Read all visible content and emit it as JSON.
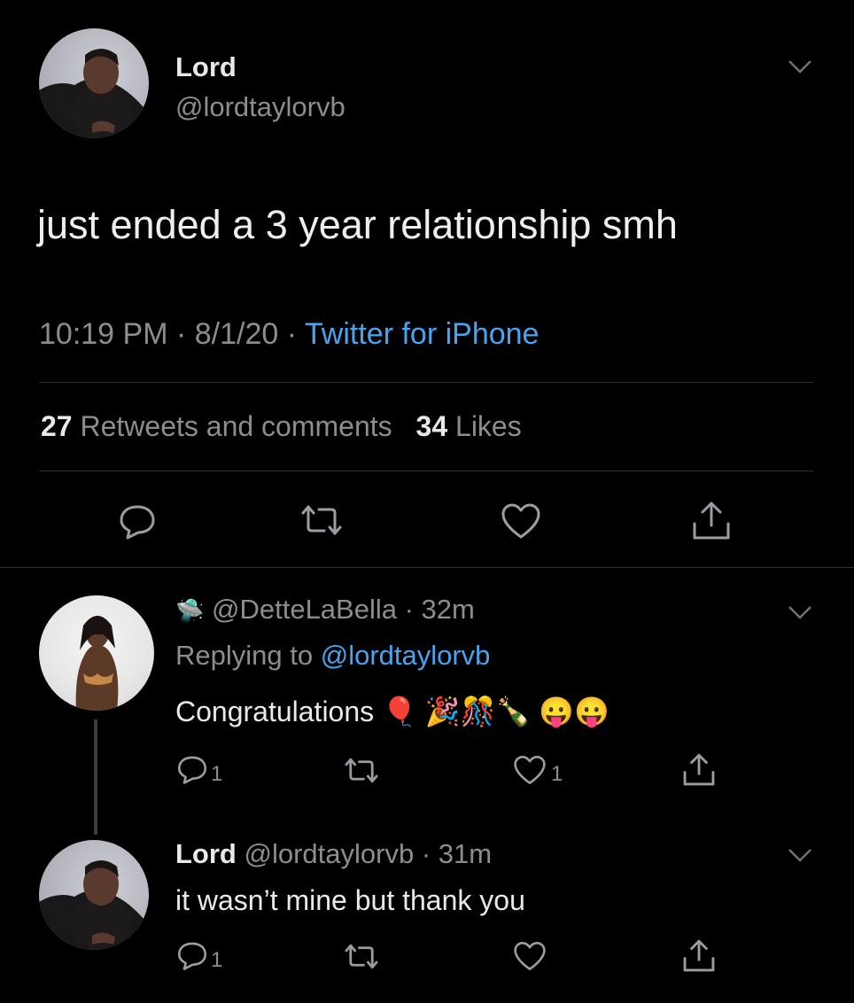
{
  "main_tweet": {
    "display_name": "Lord",
    "handle": "@lordtaylorvb",
    "text": "just ended a 3 year relationship smh",
    "time": "10:19 PM",
    "date": "8/1/20",
    "source": "Twitter for iPhone",
    "retweets_count": "27",
    "retweets_label": "Retweets and comments",
    "likes_count": "34",
    "likes_label": "Likes"
  },
  "reply1": {
    "emoji_prefix": "🛸",
    "handle": "@DetteLaBella",
    "time": "32m",
    "replying_prefix": "Replying to",
    "replying_to": "@lordtaylorvb",
    "text": "Congratulations",
    "emojis": "🎈 🎉🎊🍾 😛😛",
    "reply_count": "1",
    "like_count": "1"
  },
  "reply2": {
    "display_name": "Lord",
    "handle": "@lordtaylorvb",
    "time": "31m",
    "text": "it wasn’t mine but thank you",
    "reply_count": "1"
  }
}
